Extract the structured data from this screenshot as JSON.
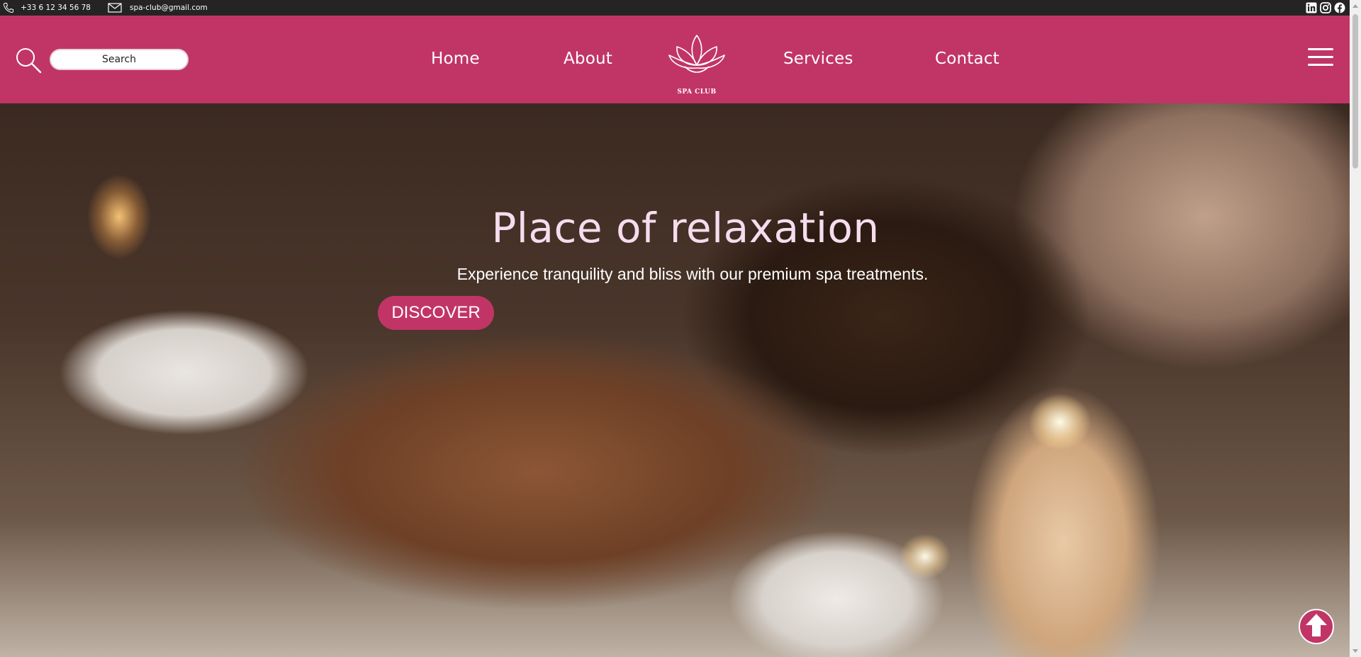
{
  "topbar": {
    "phone": "+33 6 12 34 56 78",
    "email": "spa-club@gmail.com",
    "socials": [
      "linkedin-icon",
      "instagram-icon",
      "facebook-icon"
    ]
  },
  "header": {
    "search_placeholder": "Search",
    "nav": {
      "home": "Home",
      "about": "About",
      "services": "Services",
      "contact": "Contact"
    },
    "logo_text": "SPA CLUB"
  },
  "hero": {
    "title": "Place of relaxation",
    "subtitle": "Experience tranquility and bliss with our premium spa treatments.",
    "cta": "DISCOVER"
  },
  "colors": {
    "brand": "#c13566",
    "topbar": "#242424",
    "title": "#f6dcee"
  }
}
